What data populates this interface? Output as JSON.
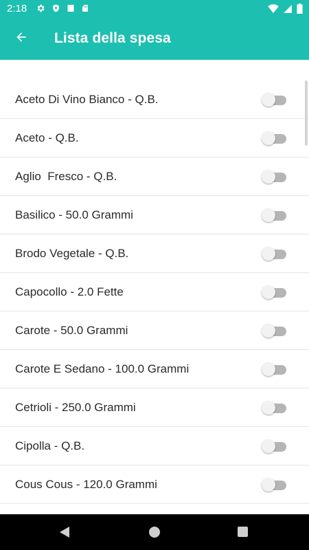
{
  "status_bar": {
    "time": "2:18",
    "icons_left": [
      "settings-icon",
      "shield-icon",
      "sd-card-icon",
      "sim-icon"
    ],
    "icons_right": [
      "wifi-icon",
      "cell-signal-icon",
      "battery-icon"
    ]
  },
  "app_bar": {
    "back_icon": "arrow-back-icon",
    "title": "Lista della spesa",
    "color": "#1dbfb0"
  },
  "shopping_list": [
    {
      "label": "Aceto Di Vino Bianco - Q.B.",
      "checked": false
    },
    {
      "label": "Aceto - Q.B.",
      "checked": false
    },
    {
      "label": "Aglio  Fresco - Q.B.",
      "checked": false
    },
    {
      "label": "Basilico - 50.0 Grammi",
      "checked": false
    },
    {
      "label": "Brodo Vegetale - Q.B.",
      "checked": false
    },
    {
      "label": "Capocollo - 2.0 Fette",
      "checked": false
    },
    {
      "label": "Carote - 50.0 Grammi",
      "checked": false
    },
    {
      "label": "Carote E Sedano - 100.0 Grammi",
      "checked": false
    },
    {
      "label": "Cetrioli - 250.0 Grammi",
      "checked": false
    },
    {
      "label": "Cipolla - Q.B.",
      "checked": false
    },
    {
      "label": "Cous Cous - 120.0 Grammi",
      "checked": false
    },
    {
      "label": "",
      "checked": false
    }
  ],
  "nav_bar": {
    "icons": [
      "back-triangle-icon",
      "home-circle-icon",
      "recents-square-icon"
    ]
  }
}
